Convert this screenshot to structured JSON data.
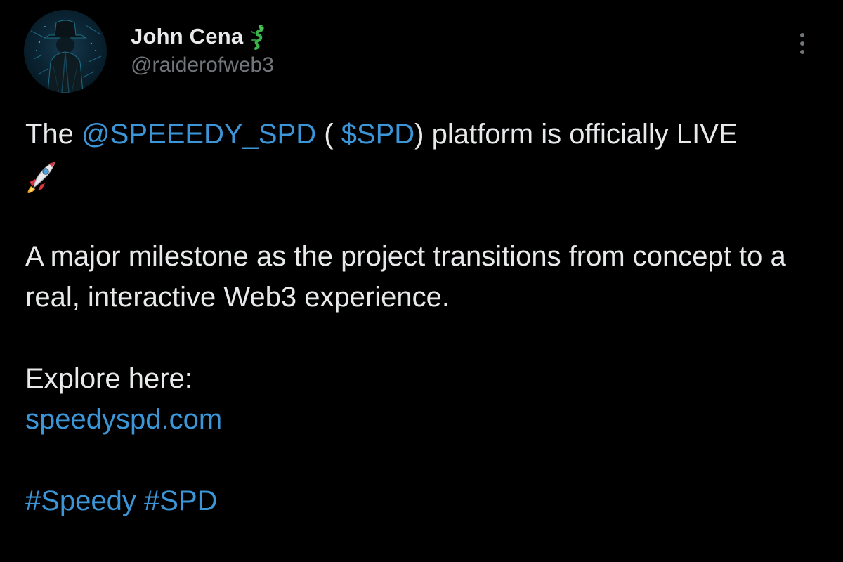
{
  "author": {
    "display_name": "John Cena",
    "name_badge_icon": "dragon-emoji",
    "handle": "@raiderofweb3",
    "avatar_icon": "hooded-figure-avatar"
  },
  "menu": {
    "icon": "more-vertical-icon"
  },
  "post": {
    "line1": {
      "prefix": "The ",
      "mention": "@SPEEEDY_SPD",
      "open_paren": " ( ",
      "cashtag": "$SPD",
      "suffix": ") platform is officially LIVE"
    },
    "rocket_icon": "rocket-emoji",
    "paragraph2": "A major milestone as the project transitions from concept to a real, interactive Web3 experience.",
    "explore_label": "Explore here:",
    "link": "speedyspd.com",
    "hashtag1": "#Speedy",
    "hashtag2": "#SPD"
  },
  "colors": {
    "background": "#000000",
    "primary_text": "#e7e9ea",
    "secondary_text": "#71767b",
    "link": "#3c95d6"
  }
}
